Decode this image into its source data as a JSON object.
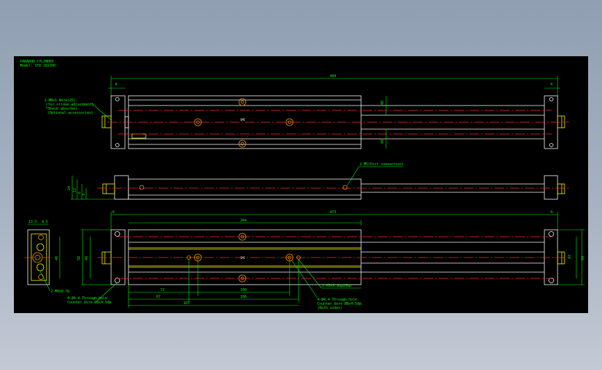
{
  "title": {
    "line1": "PARAROD CYLINDER",
    "line2": "Model: STD 16x200"
  },
  "labels": {
    "overall_length": "484",
    "dim_flange_left": "6",
    "dim_flange_right": "6",
    "dim_48_top": "48",
    "dim_48_bottom": "48",
    "note_1_l1": "2-M8x1 Bore(25)",
    "note_1_l2": "(for stroke adjustment)",
    "note_1_l3": "*Shock absorber",
    "note_1_l4": "(Optional accessories)",
    "port_note": "2-M5(Port connection)",
    "side_24": "24",
    "side_12": "12",
    "side_6": "6",
    "side_3": "3",
    "dim_264": "264",
    "dim_473": "473",
    "dim_6_b_left": "6",
    "dim_6_b_right": "6",
    "dim_58": "58",
    "dim_48_b": "48",
    "dim_47": "47",
    "dim_54": "54",
    "dim_72": "72",
    "dim_100_a": "100",
    "dim_67": "67",
    "dim_100_b": "100",
    "dim_167": "167",
    "end_13_5": "13.5",
    "end_9_5": "9.5",
    "end_48": "48",
    "end_note": "2-M4x0.7p",
    "hole_note_l1": "4-Ø4.4 Through-hole",
    "hole_note_l2": "Counter bore Ø8x4.5dp",
    "mount_note": "2-M5x0.8dpx5dp",
    "hole_note2_l1": "4-Ø4.4 Through-hole",
    "hole_note2_l2": "Counter bore Ø8x4.5dp",
    "hole_note2_l3": "(Both sides)",
    "stamp_top": "SMC",
    "stamp_bottom": "SMC"
  },
  "colors": {
    "outline": "#ffffff",
    "dimension": "#00ff00",
    "centerline": "#ff2a2a",
    "highlight": "#ffff00"
  }
}
